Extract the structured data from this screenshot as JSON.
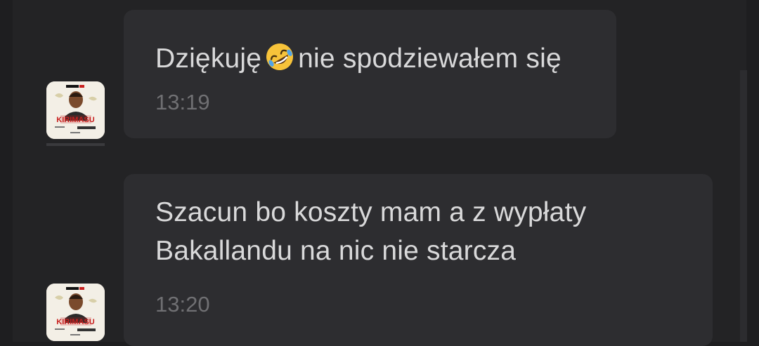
{
  "conversation": {
    "messages": [
      {
        "text_before_emoji": "Dziękuję",
        "emoji": "rolling-on-the-floor-laughing-emoji",
        "text_after_emoji": "nie spodziewałem się",
        "time": "13:19",
        "avatar": {
          "poster_title": "KIRIMASU",
          "poster_brand": "PRIME"
        }
      },
      {
        "line1": "Szacun bo koszty mam a z wypłaty",
        "line2": "Bakallandu na nic nie starcza",
        "time": "13:20",
        "avatar": {
          "poster_title": "KIRIMASU",
          "poster_brand": "PRIME"
        }
      }
    ]
  },
  "colors": {
    "background": "#1e1e20",
    "panel": "#232325",
    "bubble": "#2d2d30",
    "text": "#d9d9da",
    "timestamp": "#707073",
    "poster_red": "#c8201f"
  }
}
